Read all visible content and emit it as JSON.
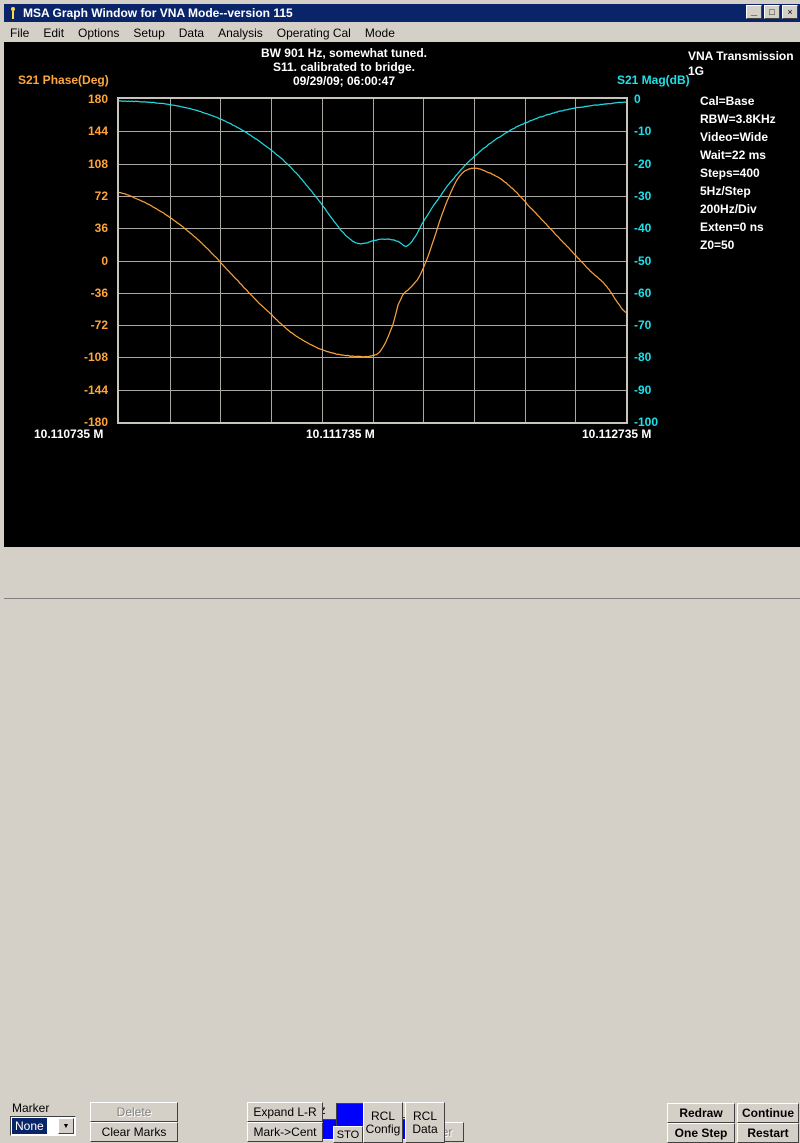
{
  "window": {
    "title": "MSA Graph Window for VNA Mode--version 115",
    "icon": "person-pin-icon",
    "controls": [
      {
        "name": "minimize-button",
        "glyph": "_"
      },
      {
        "name": "maximize-button",
        "glyph": "□"
      },
      {
        "name": "close-button",
        "glyph": "×"
      }
    ]
  },
  "menubar": {
    "items": [
      {
        "label": "File"
      },
      {
        "label": "Edit"
      },
      {
        "label": "Options"
      },
      {
        "label": "Setup"
      },
      {
        "label": "Data"
      },
      {
        "label": "Analysis"
      },
      {
        "label": "Operating Cal"
      },
      {
        "label": "Mode"
      }
    ]
  },
  "graph": {
    "titles": [
      "BW 901 Hz, somewhat tuned.",
      "S11.  calibrated to bridge.",
      "09/29/09; 06:00:47"
    ],
    "info_header": [
      "VNA Transmission",
      "1G"
    ],
    "info_items": [
      "Cal=Base",
      "RBW=3.8KHz",
      "Video=Wide",
      "Wait=22 ms",
      "Steps=400",
      "5Hz/Step",
      "200Hz/Div",
      "Exten=0 ns",
      "Z0=50"
    ]
  },
  "colors": {
    "phase": "#ffa53c",
    "mag": "#1fe0e8",
    "grid": "#a8a8a0",
    "background": "#000000",
    "window_face": "#d4d0c8",
    "titlebar": "#0a246a",
    "field_blue": "#0000ff"
  },
  "chart_data": {
    "type": "line",
    "title": "BW 901 Hz, somewhat tuned. / S11.  calibrated to bridge. / 09/29/09; 06:00:47",
    "xlabel": "",
    "grid": true,
    "legend_position": "none",
    "x_axis": {
      "ticks": [
        "10.110735 M",
        "10.111735 M",
        "10.112735 M"
      ],
      "min": 10.110735,
      "max": 10.112735,
      "unit": "MHz",
      "divisions": 10
    },
    "y_axes": [
      {
        "name": "S21 Phase(Deg)",
        "side": "left",
        "color": "#ffa53c",
        "min": -180,
        "max": 180,
        "step": 36,
        "ticks": [
          180,
          144,
          108,
          72,
          36,
          0,
          -36,
          -72,
          -108,
          -144,
          -180
        ]
      },
      {
        "name": "S21 Mag(dB)",
        "side": "right",
        "color": "#1fe0e8",
        "min": -100,
        "max": 0,
        "step": 10,
        "ticks": [
          0,
          -10,
          -20,
          -30,
          -40,
          -50,
          -60,
          -70,
          -80,
          -90,
          -100
        ]
      }
    ],
    "series": [
      {
        "name": "S21 Mag(dB)",
        "axis": "right",
        "color": "#1fe0e8",
        "x": [
          0,
          0.02,
          0.05,
          0.08,
          0.11,
          0.14,
          0.17,
          0.2,
          0.23,
          0.26,
          0.29,
          0.32,
          0.35,
          0.38,
          0.4,
          0.42,
          0.44,
          0.46,
          0.475,
          0.49,
          0.5,
          0.51,
          0.52,
          0.53,
          0.54,
          0.55,
          0.555,
          0.56,
          0.565,
          0.57,
          0.58,
          0.6,
          0.62,
          0.65,
          0.68,
          0.71,
          0.74,
          0.78,
          0.82,
          0.86,
          0.9,
          0.94,
          1.0
        ],
        "values": [
          -0.6,
          -0.7,
          -0.9,
          -1.3,
          -2.0,
          -3.0,
          -4.4,
          -6.2,
          -8.5,
          -11.3,
          -14.6,
          -18.4,
          -23.0,
          -28.5,
          -32.6,
          -37.0,
          -41.0,
          -43.9,
          -44.8,
          -44.5,
          -44.0,
          -43.6,
          -43.4,
          -43.4,
          -43.6,
          -44.1,
          -44.6,
          -45.2,
          -45.6,
          -45.2,
          -43.5,
          -38.0,
          -33.0,
          -26.5,
          -21.0,
          -16.5,
          -12.8,
          -9.0,
          -6.2,
          -4.2,
          -2.8,
          -1.9,
          -1.0
        ]
      },
      {
        "name": "S21 Phase(Deg)",
        "axis": "left",
        "color": "#ffa53c",
        "x": [
          0,
          0.03,
          0.06,
          0.09,
          0.12,
          0.15,
          0.18,
          0.21,
          0.24,
          0.27,
          0.3,
          0.33,
          0.36,
          0.39,
          0.42,
          0.45,
          0.47,
          0.49,
          0.5,
          0.51,
          0.52,
          0.53,
          0.54,
          0.545,
          0.55,
          0.56,
          0.575,
          0.59,
          0.605,
          0.62,
          0.635,
          0.65,
          0.665,
          0.68,
          0.7,
          0.72,
          0.75,
          0.78,
          0.81,
          0.84,
          0.87,
          0.9,
          0.93,
          0.96,
          1.0
        ],
        "values": [
          76,
          70,
          62,
          52,
          40,
          26,
          10,
          -8,
          -26,
          -44,
          -60,
          -76,
          -88,
          -97,
          -103,
          -106,
          -107,
          -107,
          -106,
          -104,
          -97,
          -86,
          -72,
          -62,
          -50,
          -38,
          -30,
          -20,
          -2,
          22,
          48,
          70,
          88,
          99,
          103,
          100,
          92,
          78,
          60,
          42,
          24,
          6,
          -12,
          -28,
          -58
        ]
      }
    ]
  },
  "controls": {
    "marker_label": "Marker",
    "marker_value": "None",
    "marker_arrow": "chevron-down-icon",
    "delete_label": "Delete",
    "clear_marks_label": "Clear Marks",
    "minus_label": "-",
    "plus_label": "+",
    "mhz_label": "MHz",
    "freq_value": "",
    "enter_label": "Enter",
    "expand_label": "Expand L-R",
    "mark_cent_label": "Mark->Cent",
    "sto_label": "STO",
    "rcl_config_label": [
      "RCL",
      "Config"
    ],
    "rcl_data_label": [
      "RCL",
      "Data"
    ],
    "redraw_label": "Redraw",
    "continue_label": "Continue",
    "one_step_label": "One Step",
    "restart_label": "Restart"
  }
}
